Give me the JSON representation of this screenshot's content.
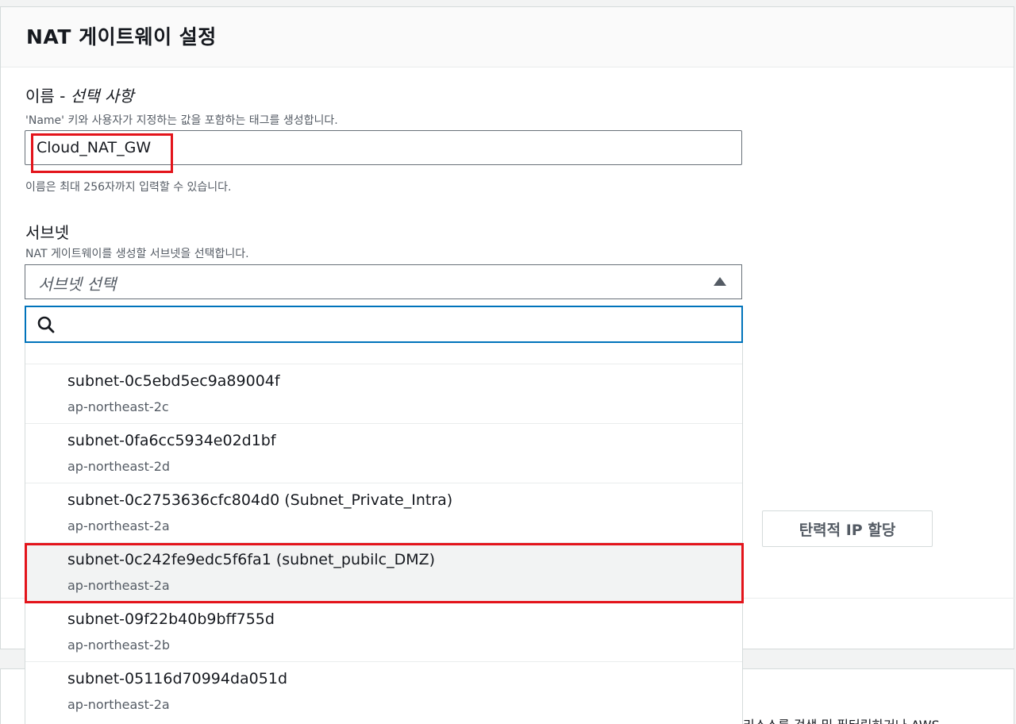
{
  "section": {
    "title": "NAT 게이트웨이 설정"
  },
  "name_field": {
    "label": "이름 - ",
    "label_optional": "선택 사항",
    "description": "'Name' 키와 사용자가 지정하는 값을 포함하는 태그를 생성합니다.",
    "value": "Cloud_NAT_GW",
    "constraint": "이름은 최대 256자까지 입력할 수 있습니다."
  },
  "subnet_field": {
    "label": "서브넷",
    "description": "NAT 게이트웨이를 생성할 서브넷을 선택합니다.",
    "placeholder": "서브넷 선택",
    "search_placeholder": "",
    "options": [
      {
        "id": "subnet-0c5ebd5ec9a89004f",
        "az": "ap-northeast-2c"
      },
      {
        "id": "subnet-0fa6cc5934e02d1bf",
        "az": "ap-northeast-2d"
      },
      {
        "id": "subnet-0c2753636cfc804d0 (Subnet_Private_Intra)",
        "az": "ap-northeast-2a"
      },
      {
        "id": "subnet-0c242fe9edc5f6fa1 (subnet_pubilc_DMZ)",
        "az": "ap-northeast-2a"
      },
      {
        "id": "subnet-09f22b40b9bff755d",
        "az": "ap-northeast-2b"
      },
      {
        "id": "subnet-05116d70994da051d",
        "az": "ap-northeast-2a"
      }
    ]
  },
  "eip_button": {
    "label": "탄력적 IP 할당"
  },
  "lower_panel": {
    "peek_text": "리소스를 검색 및 필터링하거나 AWS"
  },
  "colors": {
    "highlight": "#e3141b",
    "focus": "#0073bb",
    "selected_bg": "#f2f3f3"
  }
}
